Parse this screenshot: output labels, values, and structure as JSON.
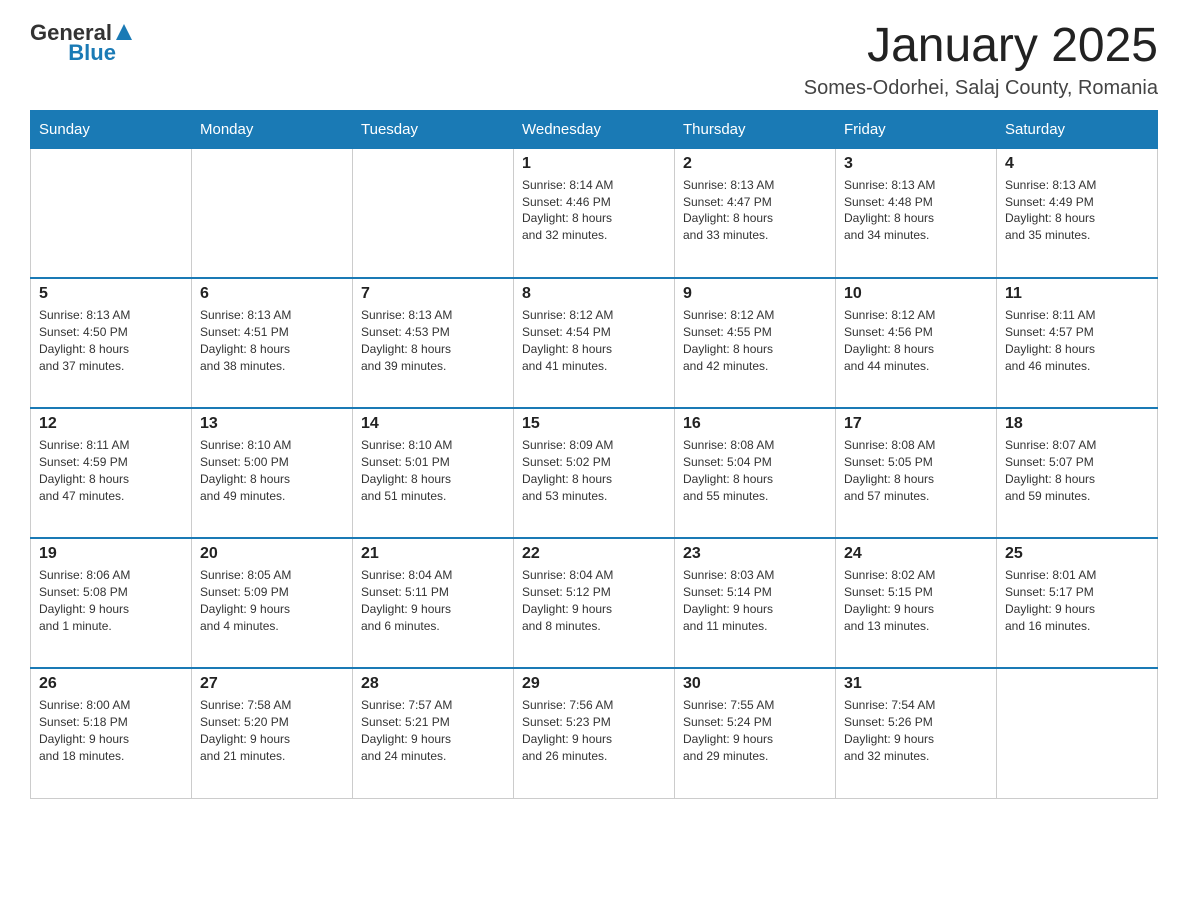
{
  "logo": {
    "text_general": "General",
    "text_blue": "Blue"
  },
  "header": {
    "month_title": "January 2025",
    "location": "Somes-Odorhei, Salaj County, Romania"
  },
  "days_of_week": [
    "Sunday",
    "Monday",
    "Tuesday",
    "Wednesday",
    "Thursday",
    "Friday",
    "Saturday"
  ],
  "weeks": [
    {
      "days": [
        {
          "number": "",
          "info": ""
        },
        {
          "number": "",
          "info": ""
        },
        {
          "number": "",
          "info": ""
        },
        {
          "number": "1",
          "info": "Sunrise: 8:14 AM\nSunset: 4:46 PM\nDaylight: 8 hours\nand 32 minutes."
        },
        {
          "number": "2",
          "info": "Sunrise: 8:13 AM\nSunset: 4:47 PM\nDaylight: 8 hours\nand 33 minutes."
        },
        {
          "number": "3",
          "info": "Sunrise: 8:13 AM\nSunset: 4:48 PM\nDaylight: 8 hours\nand 34 minutes."
        },
        {
          "number": "4",
          "info": "Sunrise: 8:13 AM\nSunset: 4:49 PM\nDaylight: 8 hours\nand 35 minutes."
        }
      ]
    },
    {
      "days": [
        {
          "number": "5",
          "info": "Sunrise: 8:13 AM\nSunset: 4:50 PM\nDaylight: 8 hours\nand 37 minutes."
        },
        {
          "number": "6",
          "info": "Sunrise: 8:13 AM\nSunset: 4:51 PM\nDaylight: 8 hours\nand 38 minutes."
        },
        {
          "number": "7",
          "info": "Sunrise: 8:13 AM\nSunset: 4:53 PM\nDaylight: 8 hours\nand 39 minutes."
        },
        {
          "number": "8",
          "info": "Sunrise: 8:12 AM\nSunset: 4:54 PM\nDaylight: 8 hours\nand 41 minutes."
        },
        {
          "number": "9",
          "info": "Sunrise: 8:12 AM\nSunset: 4:55 PM\nDaylight: 8 hours\nand 42 minutes."
        },
        {
          "number": "10",
          "info": "Sunrise: 8:12 AM\nSunset: 4:56 PM\nDaylight: 8 hours\nand 44 minutes."
        },
        {
          "number": "11",
          "info": "Sunrise: 8:11 AM\nSunset: 4:57 PM\nDaylight: 8 hours\nand 46 minutes."
        }
      ]
    },
    {
      "days": [
        {
          "number": "12",
          "info": "Sunrise: 8:11 AM\nSunset: 4:59 PM\nDaylight: 8 hours\nand 47 minutes."
        },
        {
          "number": "13",
          "info": "Sunrise: 8:10 AM\nSunset: 5:00 PM\nDaylight: 8 hours\nand 49 minutes."
        },
        {
          "number": "14",
          "info": "Sunrise: 8:10 AM\nSunset: 5:01 PM\nDaylight: 8 hours\nand 51 minutes."
        },
        {
          "number": "15",
          "info": "Sunrise: 8:09 AM\nSunset: 5:02 PM\nDaylight: 8 hours\nand 53 minutes."
        },
        {
          "number": "16",
          "info": "Sunrise: 8:08 AM\nSunset: 5:04 PM\nDaylight: 8 hours\nand 55 minutes."
        },
        {
          "number": "17",
          "info": "Sunrise: 8:08 AM\nSunset: 5:05 PM\nDaylight: 8 hours\nand 57 minutes."
        },
        {
          "number": "18",
          "info": "Sunrise: 8:07 AM\nSunset: 5:07 PM\nDaylight: 8 hours\nand 59 minutes."
        }
      ]
    },
    {
      "days": [
        {
          "number": "19",
          "info": "Sunrise: 8:06 AM\nSunset: 5:08 PM\nDaylight: 9 hours\nand 1 minute."
        },
        {
          "number": "20",
          "info": "Sunrise: 8:05 AM\nSunset: 5:09 PM\nDaylight: 9 hours\nand 4 minutes."
        },
        {
          "number": "21",
          "info": "Sunrise: 8:04 AM\nSunset: 5:11 PM\nDaylight: 9 hours\nand 6 minutes."
        },
        {
          "number": "22",
          "info": "Sunrise: 8:04 AM\nSunset: 5:12 PM\nDaylight: 9 hours\nand 8 minutes."
        },
        {
          "number": "23",
          "info": "Sunrise: 8:03 AM\nSunset: 5:14 PM\nDaylight: 9 hours\nand 11 minutes."
        },
        {
          "number": "24",
          "info": "Sunrise: 8:02 AM\nSunset: 5:15 PM\nDaylight: 9 hours\nand 13 minutes."
        },
        {
          "number": "25",
          "info": "Sunrise: 8:01 AM\nSunset: 5:17 PM\nDaylight: 9 hours\nand 16 minutes."
        }
      ]
    },
    {
      "days": [
        {
          "number": "26",
          "info": "Sunrise: 8:00 AM\nSunset: 5:18 PM\nDaylight: 9 hours\nand 18 minutes."
        },
        {
          "number": "27",
          "info": "Sunrise: 7:58 AM\nSunset: 5:20 PM\nDaylight: 9 hours\nand 21 minutes."
        },
        {
          "number": "28",
          "info": "Sunrise: 7:57 AM\nSunset: 5:21 PM\nDaylight: 9 hours\nand 24 minutes."
        },
        {
          "number": "29",
          "info": "Sunrise: 7:56 AM\nSunset: 5:23 PM\nDaylight: 9 hours\nand 26 minutes."
        },
        {
          "number": "30",
          "info": "Sunrise: 7:55 AM\nSunset: 5:24 PM\nDaylight: 9 hours\nand 29 minutes."
        },
        {
          "number": "31",
          "info": "Sunrise: 7:54 AM\nSunset: 5:26 PM\nDaylight: 9 hours\nand 32 minutes."
        },
        {
          "number": "",
          "info": ""
        }
      ]
    }
  ]
}
